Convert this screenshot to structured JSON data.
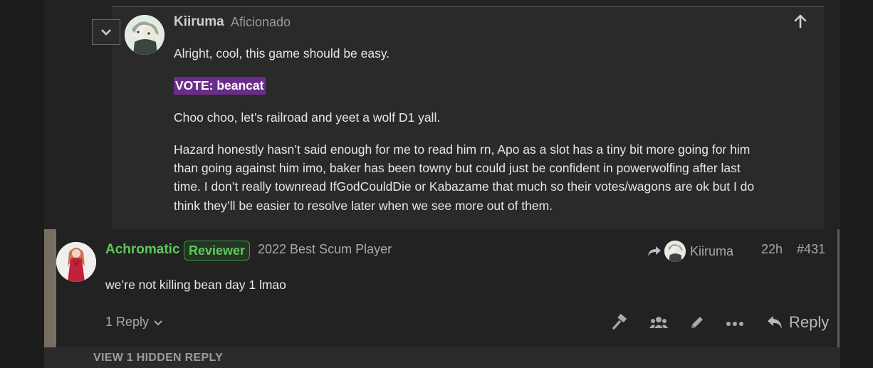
{
  "parent_post": {
    "username": "Kiiruma",
    "user_title": "Aficionado",
    "line1": "Alright, cool, this game should be easy.",
    "vote": "VOTE: beancat",
    "line2": "Choo choo, let’s railroad and yeet a wolf D1 yall.",
    "para_lines": [
      "Hazard honestly hasn’t said enough for me to read him rn, Apo as a slot has a tiny bit more going for him",
      "than going against him imo, baker has been towny but could just be confident in powerwolfing after last",
      "time. I don’t really townread IfGodCouldDie or Kabazame that much so their votes/wagons are ok but I do",
      "think they’ll be easier to resolve later when we see more out of them."
    ]
  },
  "post": {
    "username": "Achromatic",
    "badge": "Reviewer",
    "user_title": "2022 Best Scum Player",
    "reply_to_user": "Kiiruma",
    "time": "22h",
    "post_number": "#431",
    "body": "we’re not killing bean day 1 lmao",
    "replies_label": "1 Reply",
    "reply_label": "Reply"
  },
  "hidden_reply": "VIEW 1 HIDDEN REPLY",
  "colors": {
    "username_green": "#5ec85e",
    "vote_bg": "#6b2d8a"
  }
}
